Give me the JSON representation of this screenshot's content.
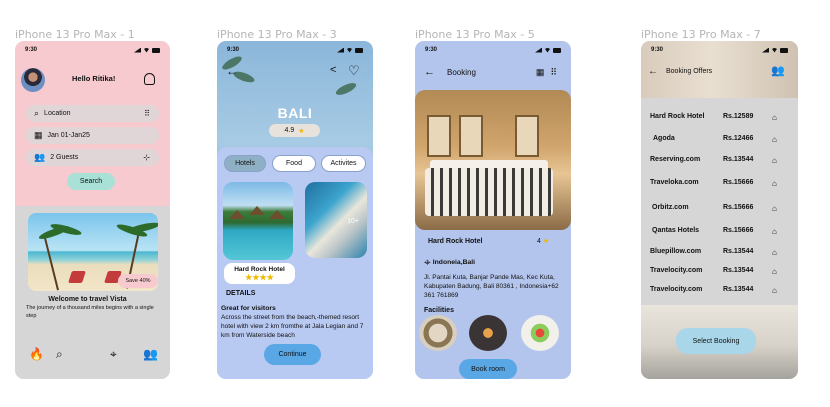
{
  "frame_labels": [
    "iPhone 13 Pro Max - 1",
    "iPhone 13 Pro Max - 3",
    "iPhone 13 Pro Max - 5",
    "iPhone 13 Pro Max - 7"
  ],
  "status_time": "9:30",
  "colors": {
    "pink": "#f6cacf",
    "lavender": "#b8c9f2",
    "blue_button": "#5aa7e6",
    "mint": "#a9e1d7",
    "gray": "#d6d6d6"
  },
  "home": {
    "greeting": "Hello Ritika!",
    "location_label": "Location",
    "dates_label": "Jan 01-Jan25",
    "guests_label": "2 Guests",
    "search_label": "Search",
    "badge": "Save 40%",
    "welcome": "Welcome to travel Vista",
    "tagline": "The journey of a thousand miles begins with a single step",
    "icons": [
      "avatar",
      "bell-icon",
      "search-icon",
      "grid-icon",
      "calendar-icon",
      "people-icon",
      "adjust-icon",
      "fire-icon",
      "search-icon",
      "location-icon",
      "people-icon"
    ]
  },
  "destination": {
    "title": "BALI",
    "rating": "4.9",
    "tabs": [
      "Hotels",
      "Food",
      "Activites"
    ],
    "hotel_name": "Hard Rock Hotel",
    "hotel_stars": "★★★★",
    "gallery_count": "10+",
    "details_heading": "DETAILS",
    "desc_title": "Great for visitors",
    "description": "Across the street from the beach,-themed resort hotel with view 2 km fromthe at Jala Legian and 7 km from Waterside beach",
    "continue_label": "Continue"
  },
  "booking": {
    "title": "Booking",
    "hotel_name": "Hard Rock Hotel",
    "rating": "4",
    "location": "Indoneia,Bali",
    "address": "Jl. Pantai Kuta, Banjar Pande Mas, Kec Kuta, Kabupaten Badung, Bali 80361 , Indonesia+62 361 761869",
    "facilities_heading": "Facilities",
    "book_label": "Book room"
  },
  "offers": {
    "title": "Booking  Offers",
    "rows": [
      {
        "name": "Hard Rock Hotel",
        "price": "Rs.12589"
      },
      {
        "name": "Agoda",
        "price": "Rs.12466"
      },
      {
        "name": "Reserving.com",
        "price": "Rs.13544"
      },
      {
        "name": "Traveloka.com",
        "price": "Rs.15666"
      },
      {
        "name": "Orbitz.com",
        "price": "Rs.15666"
      },
      {
        "name": "Qantas Hotels",
        "price": "Rs.15666"
      },
      {
        "name": "Bluepillow.com",
        "price": "Rs.13544"
      },
      {
        "name": "Travelocity.com",
        "price": "Rs.13544"
      },
      {
        "name": "Travelocity.com",
        "price": "Rs.13544"
      }
    ],
    "select_label": "Select Booking"
  }
}
